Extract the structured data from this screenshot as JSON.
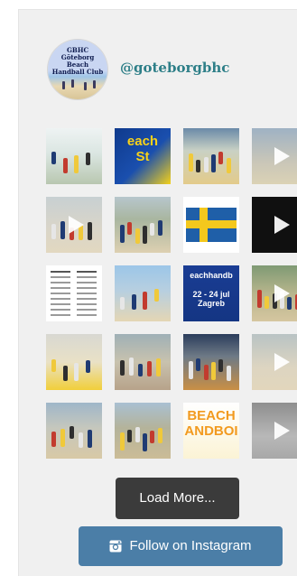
{
  "profile": {
    "handle": "@goteborgbhc",
    "avatar_text": "GBHC\nGöteborg Beach\nHandball Club"
  },
  "tiles": [
    {
      "row": 0,
      "col": 0,
      "type": "image",
      "bg": "linear-gradient(#eef3f3 0%, #dbe6e2 45%, #b9c7b0 100%)",
      "people": true,
      "video": false
    },
    {
      "row": 0,
      "col": 1,
      "type": "text",
      "bg": "linear-gradient(135deg, #0f3a8c 0%, #1a4fae 55%, #f4d11a 100%)",
      "text": "each\nSt",
      "text_color": "#f7d21a",
      "text_size": "15px",
      "video": false
    },
    {
      "row": 0,
      "col": 2,
      "type": "image",
      "bg": "linear-gradient(#6a8aa8 0%, #c9d1c4 40%, #e3cb8a 100%)",
      "people": true,
      "video": false
    },
    {
      "row": 0,
      "col": 3,
      "type": "image",
      "bg": "linear-gradient(#9fb2c4 0%, #c9c6b8 60%, #dbd2b5 100%)",
      "people": false,
      "video": true
    },
    {
      "row": 1,
      "col": 0,
      "type": "image",
      "bg": "linear-gradient(#c8d0d2 0%, #d9d5c9 55%, #e2d8c0 100%)",
      "people": true,
      "video": true
    },
    {
      "row": 1,
      "col": 1,
      "type": "image",
      "bg": "linear-gradient(#b7c6cc 0%, #a9b6a0 40%, #ddd0b1 100%)",
      "people": true,
      "video": false
    },
    {
      "row": 1,
      "col": 2,
      "type": "flag",
      "bg": "#ffffff",
      "video": false
    },
    {
      "row": 1,
      "col": 3,
      "type": "image",
      "bg": "#101010",
      "people": false,
      "video": true
    },
    {
      "row": 2,
      "col": 0,
      "type": "table",
      "bg": "#ffffff",
      "video": false
    },
    {
      "row": 2,
      "col": 1,
      "type": "image",
      "bg": "linear-gradient(#9cc6e8 0%, #b7cfe0 45%, #e4d6b4 100%)",
      "people": true,
      "video": false
    },
    {
      "row": 2,
      "col": 2,
      "type": "text",
      "bg": "linear-gradient(#1a3d94 0%, #143583 100%)",
      "text": "eachhandb\n\n 22 - 24 jul\n Zagreb",
      "text_color": "#ffffff",
      "text_size": "9px",
      "video": false
    },
    {
      "row": 2,
      "col": 3,
      "type": "image",
      "bg": "linear-gradient(#7f9a74 0%, #b7b58c 50%, #d5c6a0 100%)",
      "people": true,
      "video": true
    },
    {
      "row": 3,
      "col": 0,
      "type": "image",
      "bg": "linear-gradient(#d8d8d2 0%, #e9e1c6 50%, #f1cf3a 100%)",
      "people": true,
      "video": false
    },
    {
      "row": 3,
      "col": 1,
      "type": "image",
      "bg": "linear-gradient(#9fb0b6 0%, #c8c2ae 50%, #b7a38a 100%)",
      "people": true,
      "video": false
    },
    {
      "row": 3,
      "col": 2,
      "type": "image",
      "bg": "linear-gradient(#2b3d5c 0%, #6e7a86 40%, #c98f45 100%)",
      "people": true,
      "video": false
    },
    {
      "row": 3,
      "col": 3,
      "type": "image",
      "bg": "linear-gradient(#b9c3c4 0%, #ddd5c1 60%, #e2d6bc 100%)",
      "people": false,
      "video": true
    },
    {
      "row": 4,
      "col": 0,
      "type": "image",
      "bg": "linear-gradient(#9fb6c9 0%, #c5c7bd 45%, #d8c9a6 100%)",
      "people": true,
      "video": false
    },
    {
      "row": 4,
      "col": 1,
      "type": "image",
      "bg": "linear-gradient(#a9c0d2 0%, #b4b39a 45%, #cbbc97 100%)",
      "people": true,
      "video": false
    },
    {
      "row": 4,
      "col": 2,
      "type": "text",
      "bg": "linear-gradient(#ffffff 0%, #fbf3d5 100%)",
      "text": "BEACH\nANDBOI",
      "text_color": "#f29a1f",
      "text_size": "15px",
      "video": false
    },
    {
      "row": 4,
      "col": 3,
      "type": "image",
      "bg": "linear-gradient(#8e8e8e 0%, #b8b8b8 60%, #a8a8a8 100%)",
      "people": false,
      "video": true
    }
  ],
  "buttons": {
    "load_more": "Load More...",
    "follow": "Follow on Instagram"
  },
  "colors": {
    "panel_bg": "#f0f0f0",
    "handle": "#2e7f88",
    "load_more_bg": "#3b3b3b",
    "follow_bg": "#4b7ea7"
  }
}
